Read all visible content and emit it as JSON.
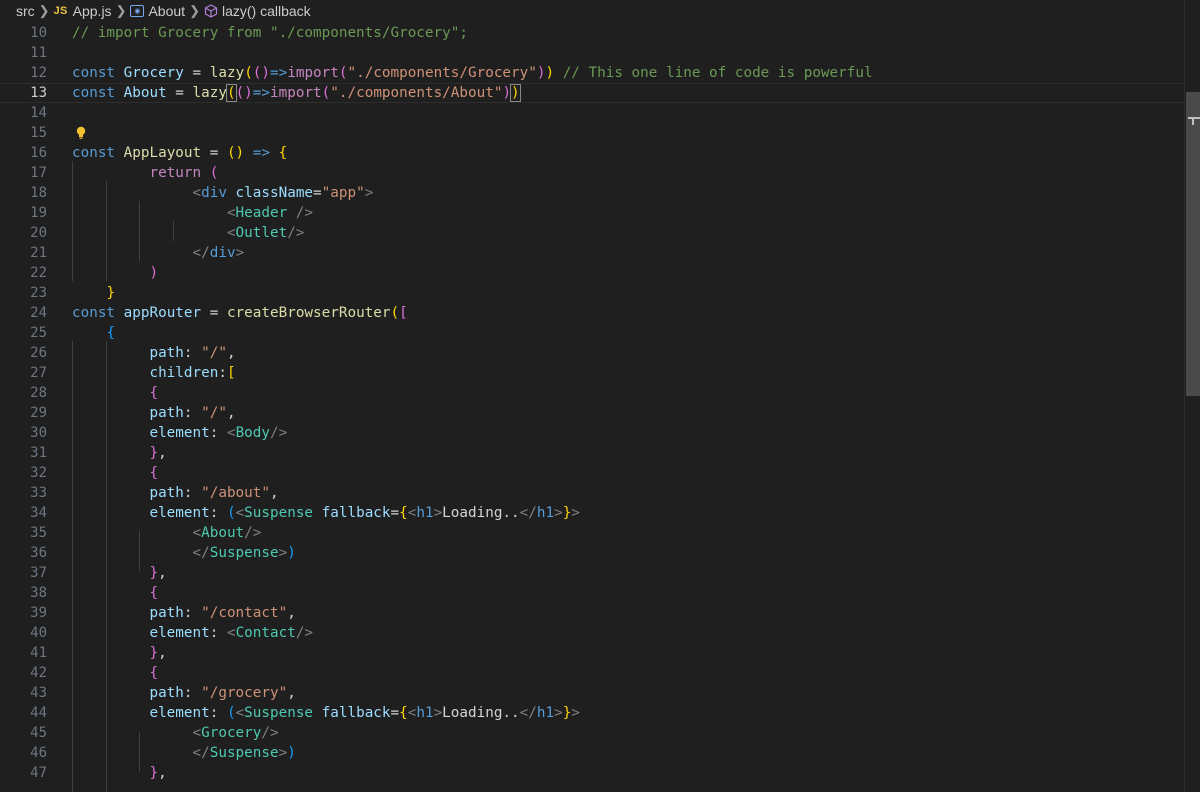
{
  "breadcrumb": {
    "folder": "src",
    "file_badge": "JS",
    "file": "App.js",
    "symbol": "About",
    "callback": "lazy() callback"
  },
  "editor": {
    "current_line": "13",
    "lines": [
      {
        "n": "10",
        "t": [
          [
            "// import Grocery from \"./components/Grocery\";",
            "cmt"
          ]
        ]
      },
      {
        "n": "11",
        "t": []
      },
      {
        "n": "12",
        "t": [
          [
            "const ",
            "kw"
          ],
          [
            "Grocery",
            "var"
          ],
          [
            " = ",
            "op"
          ],
          [
            "lazy",
            "fn"
          ],
          [
            "(",
            "b1"
          ],
          [
            "()",
            "b2"
          ],
          [
            "=>",
            "kw"
          ],
          [
            "import",
            "kwc"
          ],
          [
            "(",
            "b2"
          ],
          [
            "\"./components/Grocery\"",
            "str"
          ],
          [
            ")",
            "b2"
          ],
          [
            ")",
            "b1"
          ],
          [
            " // This one line of code is powerful",
            "cmt"
          ]
        ]
      },
      {
        "n": "13",
        "t": [
          [
            "const ",
            "kw"
          ],
          [
            "About",
            "var"
          ],
          [
            " = ",
            "op"
          ],
          [
            "lazy",
            "fn"
          ],
          [
            "(",
            "b1 bm"
          ],
          [
            "()",
            "b2"
          ],
          [
            "=>",
            "kw"
          ],
          [
            "import",
            "kwc"
          ],
          [
            "(",
            "b2"
          ],
          [
            "\"./components/About\"",
            "str"
          ],
          [
            ")",
            "b2"
          ],
          [
            ")",
            "b1 bm"
          ]
        ]
      },
      {
        "n": "14",
        "t": []
      },
      {
        "n": "15",
        "t": []
      },
      {
        "n": "16",
        "t": [
          [
            "const ",
            "kw"
          ],
          [
            "AppLayout",
            "fn"
          ],
          [
            " = ",
            "op"
          ],
          [
            "()",
            "b1"
          ],
          [
            " => ",
            "kw"
          ],
          [
            "{",
            "b1"
          ]
        ]
      },
      {
        "n": "17",
        "t": [
          [
            "         ",
            ""
          ],
          [
            "return ",
            "kwc"
          ],
          [
            "(",
            "b2"
          ]
        ]
      },
      {
        "n": "18",
        "t": [
          [
            "              ",
            ""
          ],
          [
            "<",
            "tagp"
          ],
          [
            "div",
            "kw"
          ],
          [
            " className",
            "attr"
          ],
          [
            "=",
            "op"
          ],
          [
            "\"app\"",
            "str"
          ],
          [
            ">",
            "tagp"
          ]
        ]
      },
      {
        "n": "19",
        "t": [
          [
            "                  ",
            ""
          ],
          [
            "<",
            "tagp"
          ],
          [
            "Header",
            "tag"
          ],
          [
            " />",
            "tagp"
          ]
        ]
      },
      {
        "n": "20",
        "t": [
          [
            "                  ",
            ""
          ],
          [
            "<",
            "tagp"
          ],
          [
            "Outlet",
            "tag"
          ],
          [
            "/>",
            "tagp"
          ]
        ]
      },
      {
        "n": "21",
        "t": [
          [
            "              ",
            ""
          ],
          [
            "</",
            "tagp"
          ],
          [
            "div",
            "kw"
          ],
          [
            ">",
            "tagp"
          ]
        ]
      },
      {
        "n": "22",
        "t": [
          [
            "         ",
            ""
          ],
          [
            ")",
            "b2"
          ]
        ]
      },
      {
        "n": "23",
        "t": [
          [
            "    ",
            ""
          ],
          [
            "}",
            "b1"
          ]
        ]
      },
      {
        "n": "24",
        "t": [
          [
            "const ",
            "kw"
          ],
          [
            "appRouter",
            "var"
          ],
          [
            " = ",
            "op"
          ],
          [
            "createBrowserRouter",
            "fn"
          ],
          [
            "(",
            "b1"
          ],
          [
            "[",
            "b2"
          ]
        ]
      },
      {
        "n": "25",
        "t": [
          [
            "    ",
            ""
          ],
          [
            "{",
            "b3"
          ]
        ]
      },
      {
        "n": "26",
        "t": [
          [
            "         ",
            ""
          ],
          [
            "path",
            "var"
          ],
          [
            ": ",
            "plain"
          ],
          [
            "\"/\"",
            "str"
          ],
          [
            ",",
            "plain"
          ]
        ]
      },
      {
        "n": "27",
        "t": [
          [
            "         ",
            ""
          ],
          [
            "children",
            "var"
          ],
          [
            ":",
            "plain"
          ],
          [
            "[",
            "b1"
          ]
        ]
      },
      {
        "n": "28",
        "t": [
          [
            "         ",
            ""
          ],
          [
            "{",
            "b2"
          ]
        ]
      },
      {
        "n": "29",
        "t": [
          [
            "         ",
            ""
          ],
          [
            "path",
            "var"
          ],
          [
            ": ",
            "plain"
          ],
          [
            "\"/\"",
            "str"
          ],
          [
            ",",
            "plain"
          ]
        ]
      },
      {
        "n": "30",
        "t": [
          [
            "         ",
            ""
          ],
          [
            "element",
            "var"
          ],
          [
            ": ",
            "plain"
          ],
          [
            "<",
            "tagp"
          ],
          [
            "Body",
            "tag"
          ],
          [
            "/>",
            "tagp"
          ]
        ]
      },
      {
        "n": "31",
        "t": [
          [
            "         ",
            ""
          ],
          [
            "}",
            "b2"
          ],
          [
            ",",
            "plain"
          ]
        ]
      },
      {
        "n": "32",
        "t": [
          [
            "         ",
            ""
          ],
          [
            "{",
            "b2"
          ]
        ]
      },
      {
        "n": "33",
        "t": [
          [
            "         ",
            ""
          ],
          [
            "path",
            "var"
          ],
          [
            ": ",
            "plain"
          ],
          [
            "\"/about\"",
            "str"
          ],
          [
            ",",
            "plain"
          ]
        ]
      },
      {
        "n": "34",
        "t": [
          [
            "         ",
            ""
          ],
          [
            "element",
            "var"
          ],
          [
            ": ",
            "plain"
          ],
          [
            "(",
            "b3"
          ],
          [
            "<",
            "tagp"
          ],
          [
            "Suspense",
            "tag"
          ],
          [
            " fallback",
            "attr"
          ],
          [
            "=",
            "op"
          ],
          [
            "{",
            "b1"
          ],
          [
            "<",
            "tagp"
          ],
          [
            "h1",
            "kw"
          ],
          [
            ">",
            "tagp"
          ],
          [
            "Loading..",
            "plain"
          ],
          [
            "</",
            "tagp"
          ],
          [
            "h1",
            "kw"
          ],
          [
            ">",
            "tagp"
          ],
          [
            "}",
            "b1"
          ],
          [
            ">",
            "tagp"
          ]
        ]
      },
      {
        "n": "35",
        "t": [
          [
            "              ",
            ""
          ],
          [
            "<",
            "tagp"
          ],
          [
            "About",
            "tag"
          ],
          [
            "/>",
            "tagp"
          ]
        ]
      },
      {
        "n": "36",
        "t": [
          [
            "              ",
            ""
          ],
          [
            "</",
            "tagp"
          ],
          [
            "Suspense",
            "tag"
          ],
          [
            ">",
            "tagp"
          ],
          [
            ")",
            "b3"
          ]
        ]
      },
      {
        "n": "37",
        "t": [
          [
            "         ",
            ""
          ],
          [
            "}",
            "b2"
          ],
          [
            ",",
            "plain"
          ]
        ]
      },
      {
        "n": "38",
        "t": [
          [
            "         ",
            ""
          ],
          [
            "{",
            "b2"
          ]
        ]
      },
      {
        "n": "39",
        "t": [
          [
            "         ",
            ""
          ],
          [
            "path",
            "var"
          ],
          [
            ": ",
            "plain"
          ],
          [
            "\"/contact\"",
            "str"
          ],
          [
            ",",
            "plain"
          ]
        ]
      },
      {
        "n": "40",
        "t": [
          [
            "         ",
            ""
          ],
          [
            "element",
            "var"
          ],
          [
            ": ",
            "plain"
          ],
          [
            "<",
            "tagp"
          ],
          [
            "Contact",
            "tag"
          ],
          [
            "/>",
            "tagp"
          ]
        ]
      },
      {
        "n": "41",
        "t": [
          [
            "         ",
            ""
          ],
          [
            "}",
            "b2"
          ],
          [
            ",",
            "plain"
          ]
        ]
      },
      {
        "n": "42",
        "t": [
          [
            "         ",
            ""
          ],
          [
            "{",
            "b2"
          ]
        ]
      },
      {
        "n": "43",
        "t": [
          [
            "         ",
            ""
          ],
          [
            "path",
            "var"
          ],
          [
            ": ",
            "plain"
          ],
          [
            "\"/grocery\"",
            "str"
          ],
          [
            ",",
            "plain"
          ]
        ]
      },
      {
        "n": "44",
        "t": [
          [
            "         ",
            ""
          ],
          [
            "element",
            "var"
          ],
          [
            ": ",
            "plain"
          ],
          [
            "(",
            "b3"
          ],
          [
            "<",
            "tagp"
          ],
          [
            "Suspense",
            "tag"
          ],
          [
            " fallback",
            "attr"
          ],
          [
            "=",
            "op"
          ],
          [
            "{",
            "b1"
          ],
          [
            "<",
            "tagp"
          ],
          [
            "h1",
            "kw"
          ],
          [
            ">",
            "tagp"
          ],
          [
            "Loading..",
            "plain"
          ],
          [
            "</",
            "tagp"
          ],
          [
            "h1",
            "kw"
          ],
          [
            ">",
            "tagp"
          ],
          [
            "}",
            "b1"
          ],
          [
            ">",
            "tagp"
          ]
        ]
      },
      {
        "n": "45",
        "t": [
          [
            "              ",
            ""
          ],
          [
            "<",
            "tagp"
          ],
          [
            "Grocery",
            "tag"
          ],
          [
            "/>",
            "tagp"
          ]
        ]
      },
      {
        "n": "46",
        "t": [
          [
            "              ",
            ""
          ],
          [
            "</",
            "tagp"
          ],
          [
            "Suspense",
            "tag"
          ],
          [
            ">",
            "tagp"
          ],
          [
            ")",
            "b3"
          ]
        ]
      },
      {
        "n": "47",
        "t": [
          [
            "         ",
            ""
          ],
          [
            "}",
            "b2"
          ],
          [
            ",",
            "plain"
          ]
        ]
      }
    ]
  },
  "icons": {
    "lightbulb": "lightbulb-icon",
    "module": "module-icon",
    "method": "method-cube-icon"
  },
  "colors": {
    "background": "#1f1f1f",
    "keyword": "#569cd6",
    "string": "#ce9178",
    "comment": "#6a9955",
    "tag": "#4ec9b0",
    "bracket_gold": "#ffd700",
    "bracket_purple": "#da70d6",
    "bracket_blue": "#179fff"
  }
}
